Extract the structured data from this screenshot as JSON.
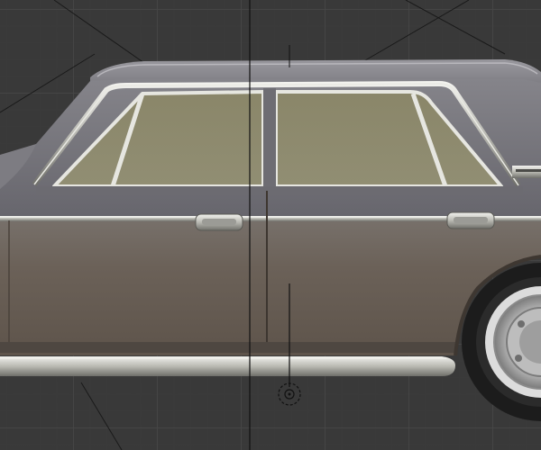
{
  "viewport": {
    "view": "side-orthographic",
    "object": "sedan-car-model",
    "colors": {
      "background": "#393939",
      "grid_major": "#464646",
      "grid_minor": "#3e3e3e",
      "body_upper": "#6f6e74",
      "body_lower": "#6b6158",
      "glass": "#8d8a6c",
      "chrome": "#d9d9d4",
      "guide_line": "#111111"
    },
    "icons": [
      "object-origin-icon",
      "tire-icon"
    ]
  }
}
